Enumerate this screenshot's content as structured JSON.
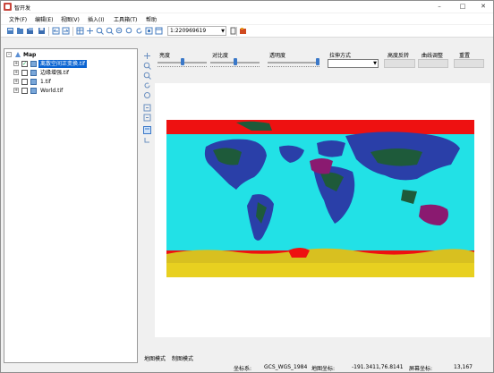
{
  "window": {
    "title": "智开发"
  },
  "menu": [
    "文件(F)",
    "编辑(E)",
    "视图(V)",
    "插入(I)",
    "工具箱(T)",
    "帮助"
  ],
  "toolbar": {
    "scale_value": "1:220969619"
  },
  "tree": {
    "root": "Map",
    "layers": [
      {
        "label": "离散空间正变换.tif",
        "checked": true,
        "selected": true
      },
      {
        "label": "边缘增强.tif",
        "checked": false,
        "selected": false
      },
      {
        "label": "1.tif",
        "checked": false,
        "selected": false
      },
      {
        "label": "World.tif",
        "checked": false,
        "selected": false
      }
    ]
  },
  "controls": {
    "brightness_label": "亮度",
    "brightness_value": 0.5,
    "contrast_label": "对比度",
    "contrast_value": 0.5,
    "transparency_label": "透明度",
    "transparency_value": 1.0,
    "stretch_label": "拉伸方式",
    "stretch_value": "",
    "highlight_invert_label": "高度反转",
    "color_adjust_label": "曲线调整",
    "reset_label": "重置"
  },
  "tabs": [
    "地图模式",
    "制图模式"
  ],
  "status": {
    "crs_label": "坐标系:",
    "crs_value": "GCS_WGS_1984",
    "map_coord_label": "地图坐标:",
    "map_coord_value": "-191.3411,76.8141",
    "screen_coord_label": "屏幕坐标:",
    "screen_coord_value": "13,167"
  },
  "colors": {
    "map_ocean": "#22e1e6",
    "map_land_green": "#1e5a3a",
    "map_land_blue": "#2a3fa8",
    "map_land_purple": "#8a1a70",
    "map_band_red": "#ee1111",
    "map_band_yellow": "#e8d020"
  }
}
